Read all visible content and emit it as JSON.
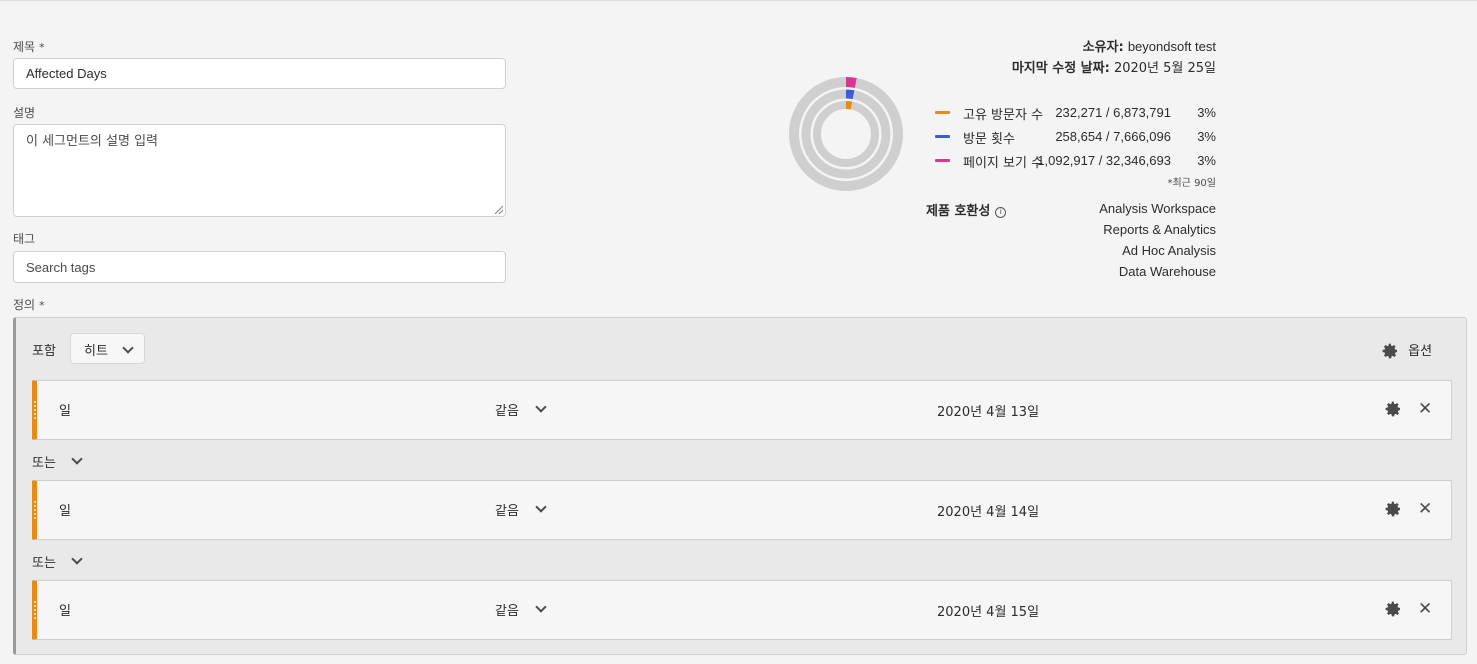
{
  "form": {
    "title_label": "제목",
    "required_mark": "*",
    "title_value": "Affected Days",
    "desc_label": "설명",
    "desc_placeholder": "이 세그먼트의 설명 입력",
    "tags_label": "태그",
    "tags_placeholder": "Search tags",
    "definition_label": "정의"
  },
  "info": {
    "owner_label": "소유자:",
    "owner_value": "beyondsoft test",
    "modified_label": "마지막 수정 날짜:",
    "modified_value": "2020년 5월 25일",
    "metrics": [
      {
        "name": "고유 방문자 수",
        "value": "232,271 / 6,873,791",
        "pct": "3%",
        "color": "#e88b17"
      },
      {
        "name": "방문 횟수",
        "value": "258,654 / 7,666,096",
        "pct": "3%",
        "color": "#3f5bd6"
      },
      {
        "name": "페이지 보기 수",
        "value": "1,092,917 / 32,346,693",
        "pct": "3%",
        "color": "#d83790"
      }
    ],
    "recent_note": "*최근 90일",
    "compat_heading": "제품 호환성",
    "compat_info_icon": "i",
    "compat_products": [
      "Analysis Workspace",
      "Reports & Analytics",
      "Ad Hoc Analysis",
      "Data Warehouse"
    ],
    "donut_fraction": 0.03
  },
  "definition": {
    "include_label": "포함",
    "scope_value": "히트",
    "options_label": "옵션",
    "or_label": "또는",
    "rules": [
      {
        "dimension": "일",
        "operator": "같음",
        "value": "2020년 4월 13일"
      },
      {
        "dimension": "일",
        "operator": "같음",
        "value": "2020년 4월 14일"
      },
      {
        "dimension": "일",
        "operator": "같음",
        "value": "2020년 4월 15일"
      }
    ],
    "close_glyph": "✕"
  }
}
